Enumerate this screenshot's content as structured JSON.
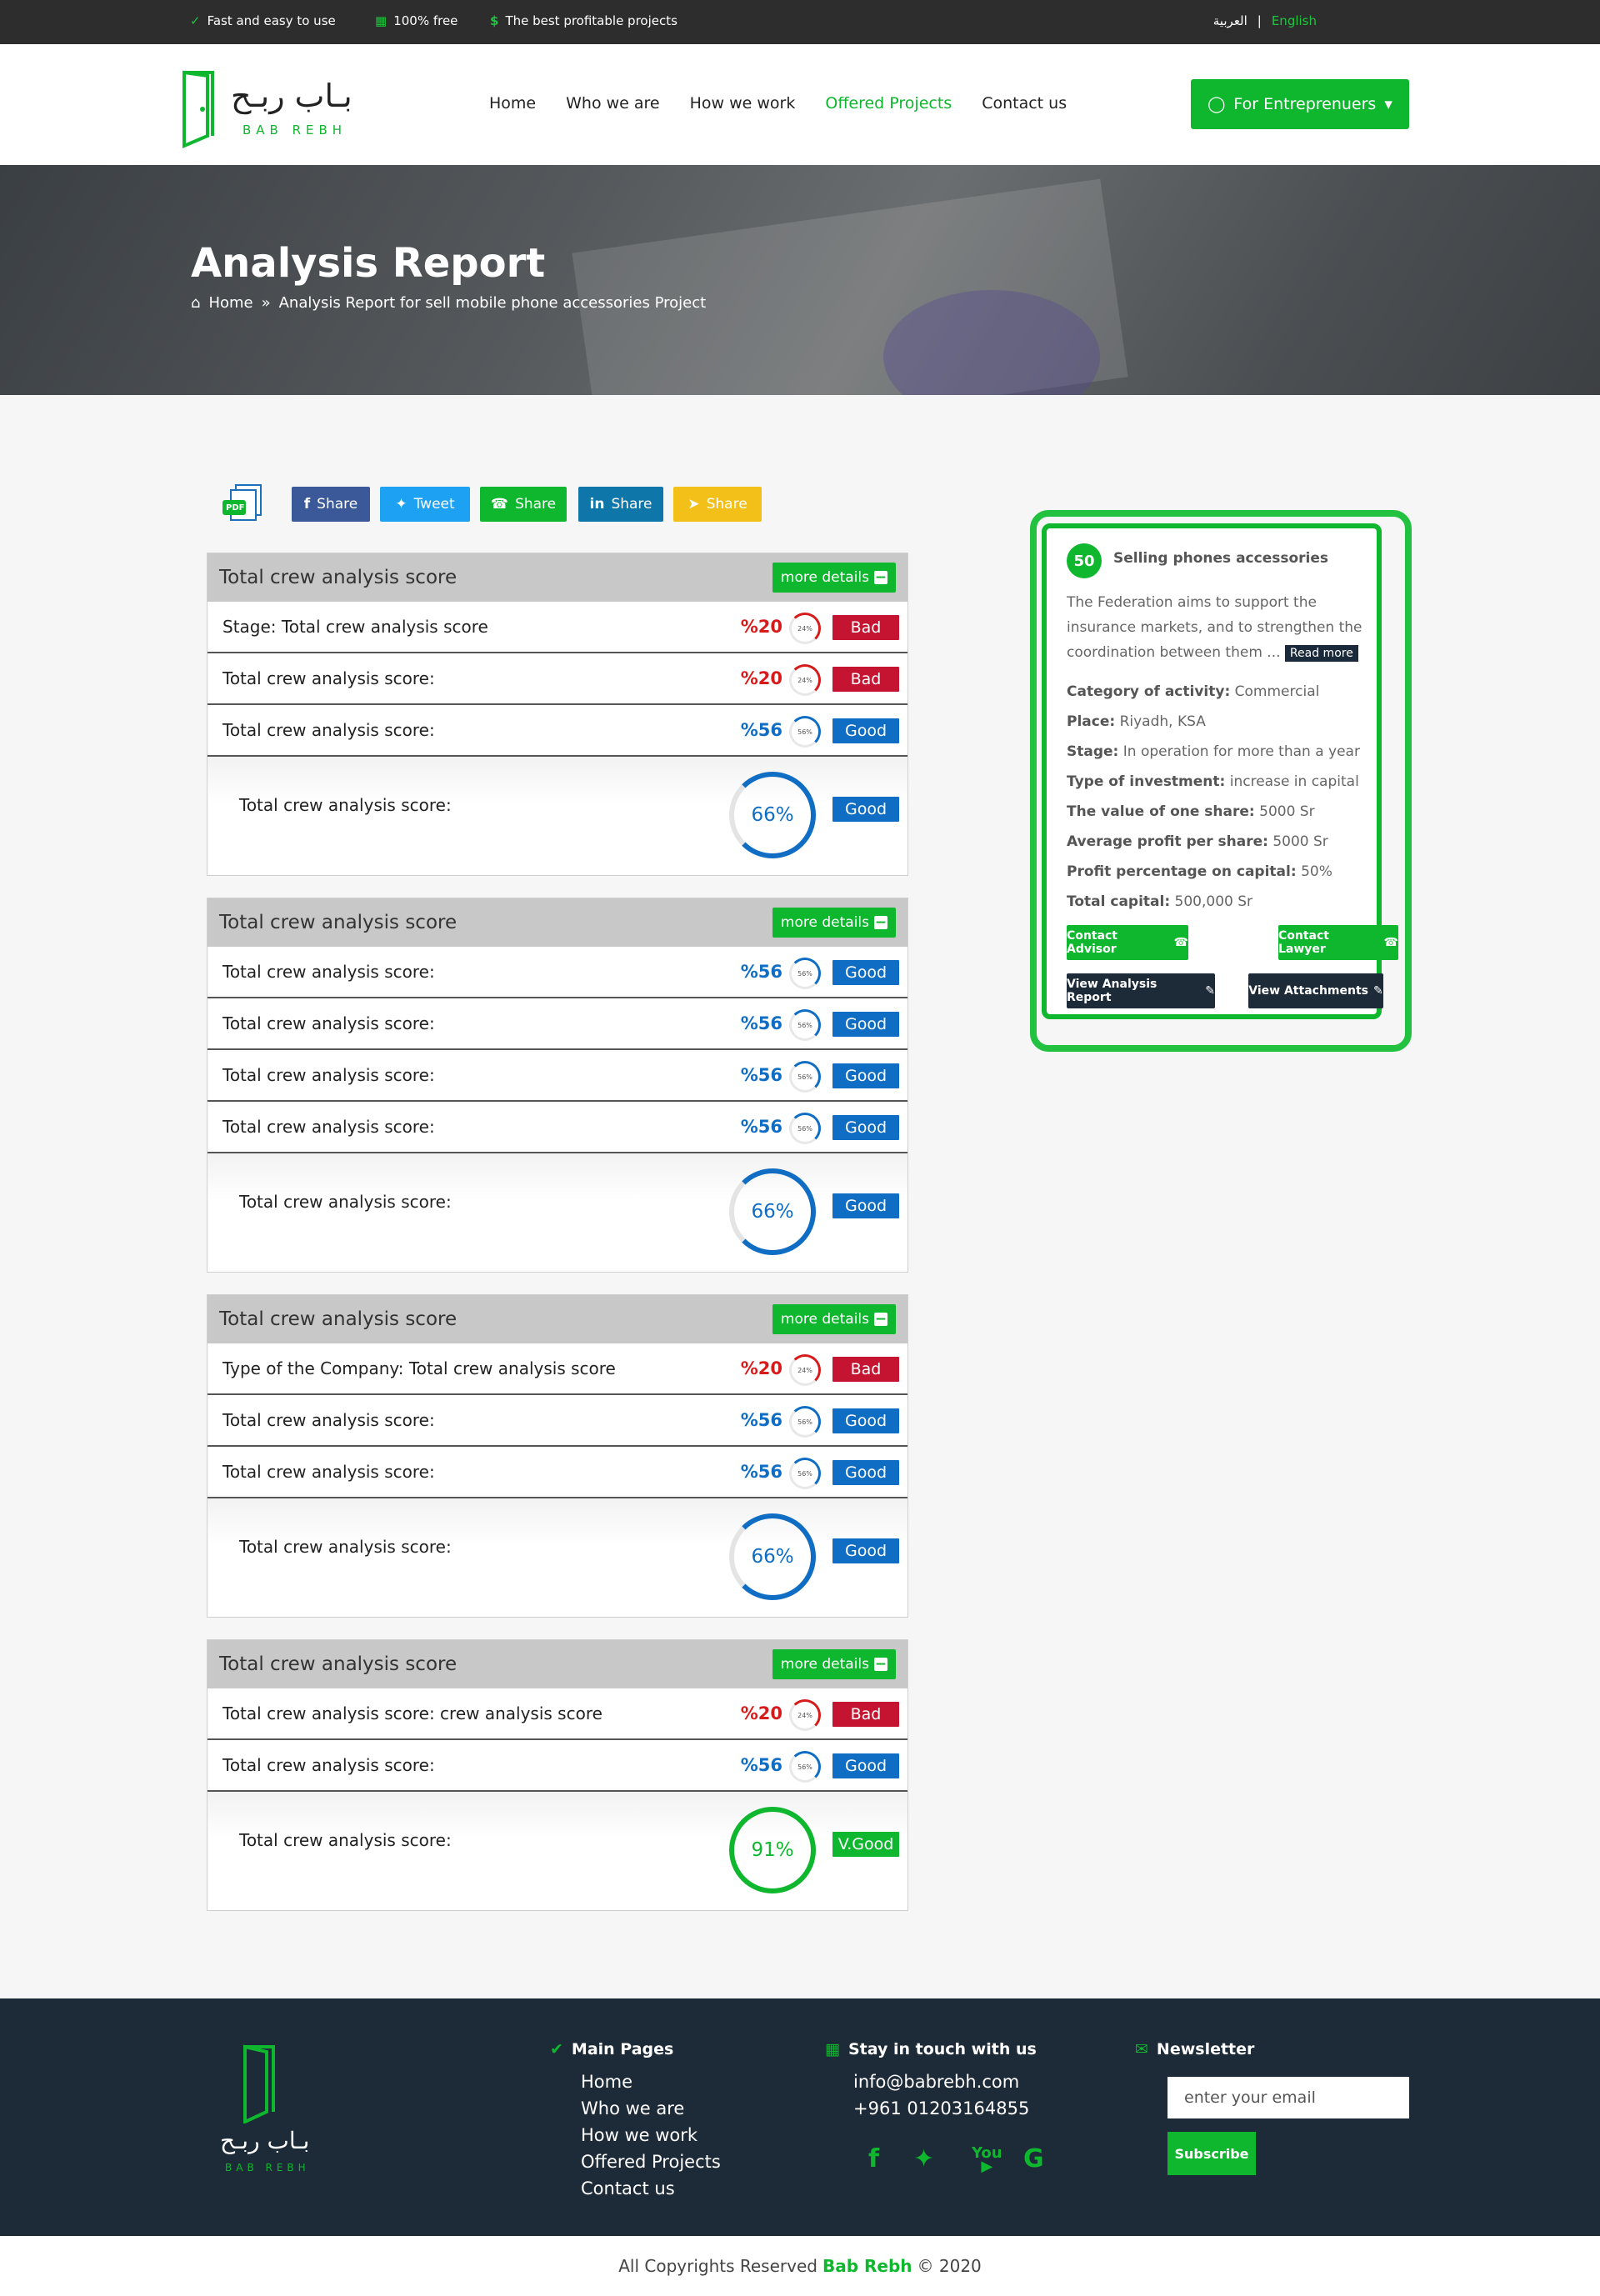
{
  "topbar": {
    "features": [
      "Fast and easy to use",
      "100% free",
      "The best profitable projects"
    ],
    "lang_ar": "العربية",
    "lang_en": "English"
  },
  "header": {
    "logo_ar": "بـاب ربـح",
    "logo_en": "BAB REBH",
    "nav": [
      "Home",
      "Who we are",
      "How we work",
      "Offered Projects",
      "Contact us"
    ],
    "active_nav": "Offered Projects",
    "cta": "For Entreprenuers"
  },
  "hero": {
    "title": "Analysis Report",
    "breadcrumb_home": "Home",
    "breadcrumb_current": "Analysis Report for sell mobile phone accessories Project"
  },
  "share": {
    "pdf": "PDF",
    "facebook": "Share",
    "twitter": "Tweet",
    "whatsapp": "Share",
    "linkedin": "Share",
    "telegram": "Share"
  },
  "panels": [
    {
      "title": "Total crew analysis score",
      "more": "more details",
      "rows": [
        {
          "label": "Stage: Total crew analysis score",
          "pct": "%20",
          "ring": "24%",
          "status": "Bad"
        },
        {
          "label": "Total crew analysis score:",
          "pct": "%20",
          "ring": "24%",
          "status": "Bad"
        },
        {
          "label": "Total crew analysis score:",
          "pct": "%56",
          "ring": "56%",
          "status": "Good"
        }
      ],
      "summary": {
        "label": "Total crew analysis score:",
        "value": "66%",
        "status": "Good"
      }
    },
    {
      "title": "Total crew analysis score",
      "more": "more details",
      "rows": [
        {
          "label": "Total crew analysis score:",
          "pct": "%56",
          "ring": "56%",
          "status": "Good"
        },
        {
          "label": "Total crew analysis score:",
          "pct": "%56",
          "ring": "56%",
          "status": "Good"
        },
        {
          "label": "Total crew analysis score:",
          "pct": "%56",
          "ring": "56%",
          "status": "Good"
        },
        {
          "label": "Total crew analysis score:",
          "pct": "%56",
          "ring": "56%",
          "status": "Good"
        }
      ],
      "summary": {
        "label": "Total crew analysis score:",
        "value": "66%",
        "status": "Good"
      }
    },
    {
      "title": "Total crew analysis score",
      "more": "more details",
      "rows": [
        {
          "label": "Type of the Company: Total crew analysis score",
          "pct": "%20",
          "ring": "24%",
          "status": "Bad"
        },
        {
          "label": "Total crew analysis score:",
          "pct": "%56",
          "ring": "56%",
          "status": "Good"
        },
        {
          "label": "Total crew analysis score:",
          "pct": "%56",
          "ring": "56%",
          "status": "Good"
        }
      ],
      "summary": {
        "label": "Total crew analysis score:",
        "value": "66%",
        "status": "Good"
      }
    },
    {
      "title": "Total crew analysis score",
      "more": "more details",
      "rows": [
        {
          "label": "Total crew analysis score: crew analysis score",
          "pct": "%20",
          "ring": "24%",
          "status": "Bad"
        },
        {
          "label": "Total crew analysis score:",
          "pct": "%56",
          "ring": "56%",
          "status": "Good"
        }
      ],
      "summary": {
        "label": "Total crew analysis score:",
        "value": "91%",
        "status": "V.Good"
      }
    }
  ],
  "card": {
    "number": "50",
    "title": "Selling phones accessories",
    "desc": "The Federation aims to support the insurance markets, and to strengthen the coordination between them ...",
    "read_more": "Read more",
    "fields": [
      {
        "k": "Category of activity:",
        "v": "Commercial"
      },
      {
        "k": "Place:",
        "v": "Riyadh, KSA"
      },
      {
        "k": "Stage:",
        "v": "In operation for more than a year"
      },
      {
        "k": "Type of investment:",
        "v": "increase in capital"
      },
      {
        "k": "The value of one share:",
        "v": "5000 Sr"
      },
      {
        "k": "Average profit per share:",
        "v": "5000 Sr"
      },
      {
        "k": "Profit percentage on capital:",
        "v": "50%"
      },
      {
        "k": "Total capital:",
        "v": "500,000 Sr"
      }
    ],
    "contact_advisor": "Contact Advisor",
    "contact_lawyer": "Contact Lawyer",
    "view_report": "View Analysis Report",
    "view_attachments": "View Attachments"
  },
  "footer": {
    "logo_ar": "بـاب ربـح",
    "logo_en": "BAB REBH",
    "main_pages_title": "Main Pages",
    "main_pages": [
      "Home",
      "Who we are",
      "How we work",
      "Offered Projects",
      "Contact us"
    ],
    "contact_title": "Stay in touch with us",
    "email": "info@babrebh.com",
    "phone": "+961 01203164855",
    "newsletter_title": "Newsletter",
    "email_placeholder": "enter your email",
    "subscribe": "Subscribe",
    "copy_pre": "All Copyrights Reserved",
    "copy_brand": "Bab Rebh",
    "copy_post": "© 2020"
  },
  "colors": {
    "brand_green": "#0eb72e",
    "bad": "#c41431",
    "good": "#0f6ec4",
    "dark": "#1d2a37"
  }
}
